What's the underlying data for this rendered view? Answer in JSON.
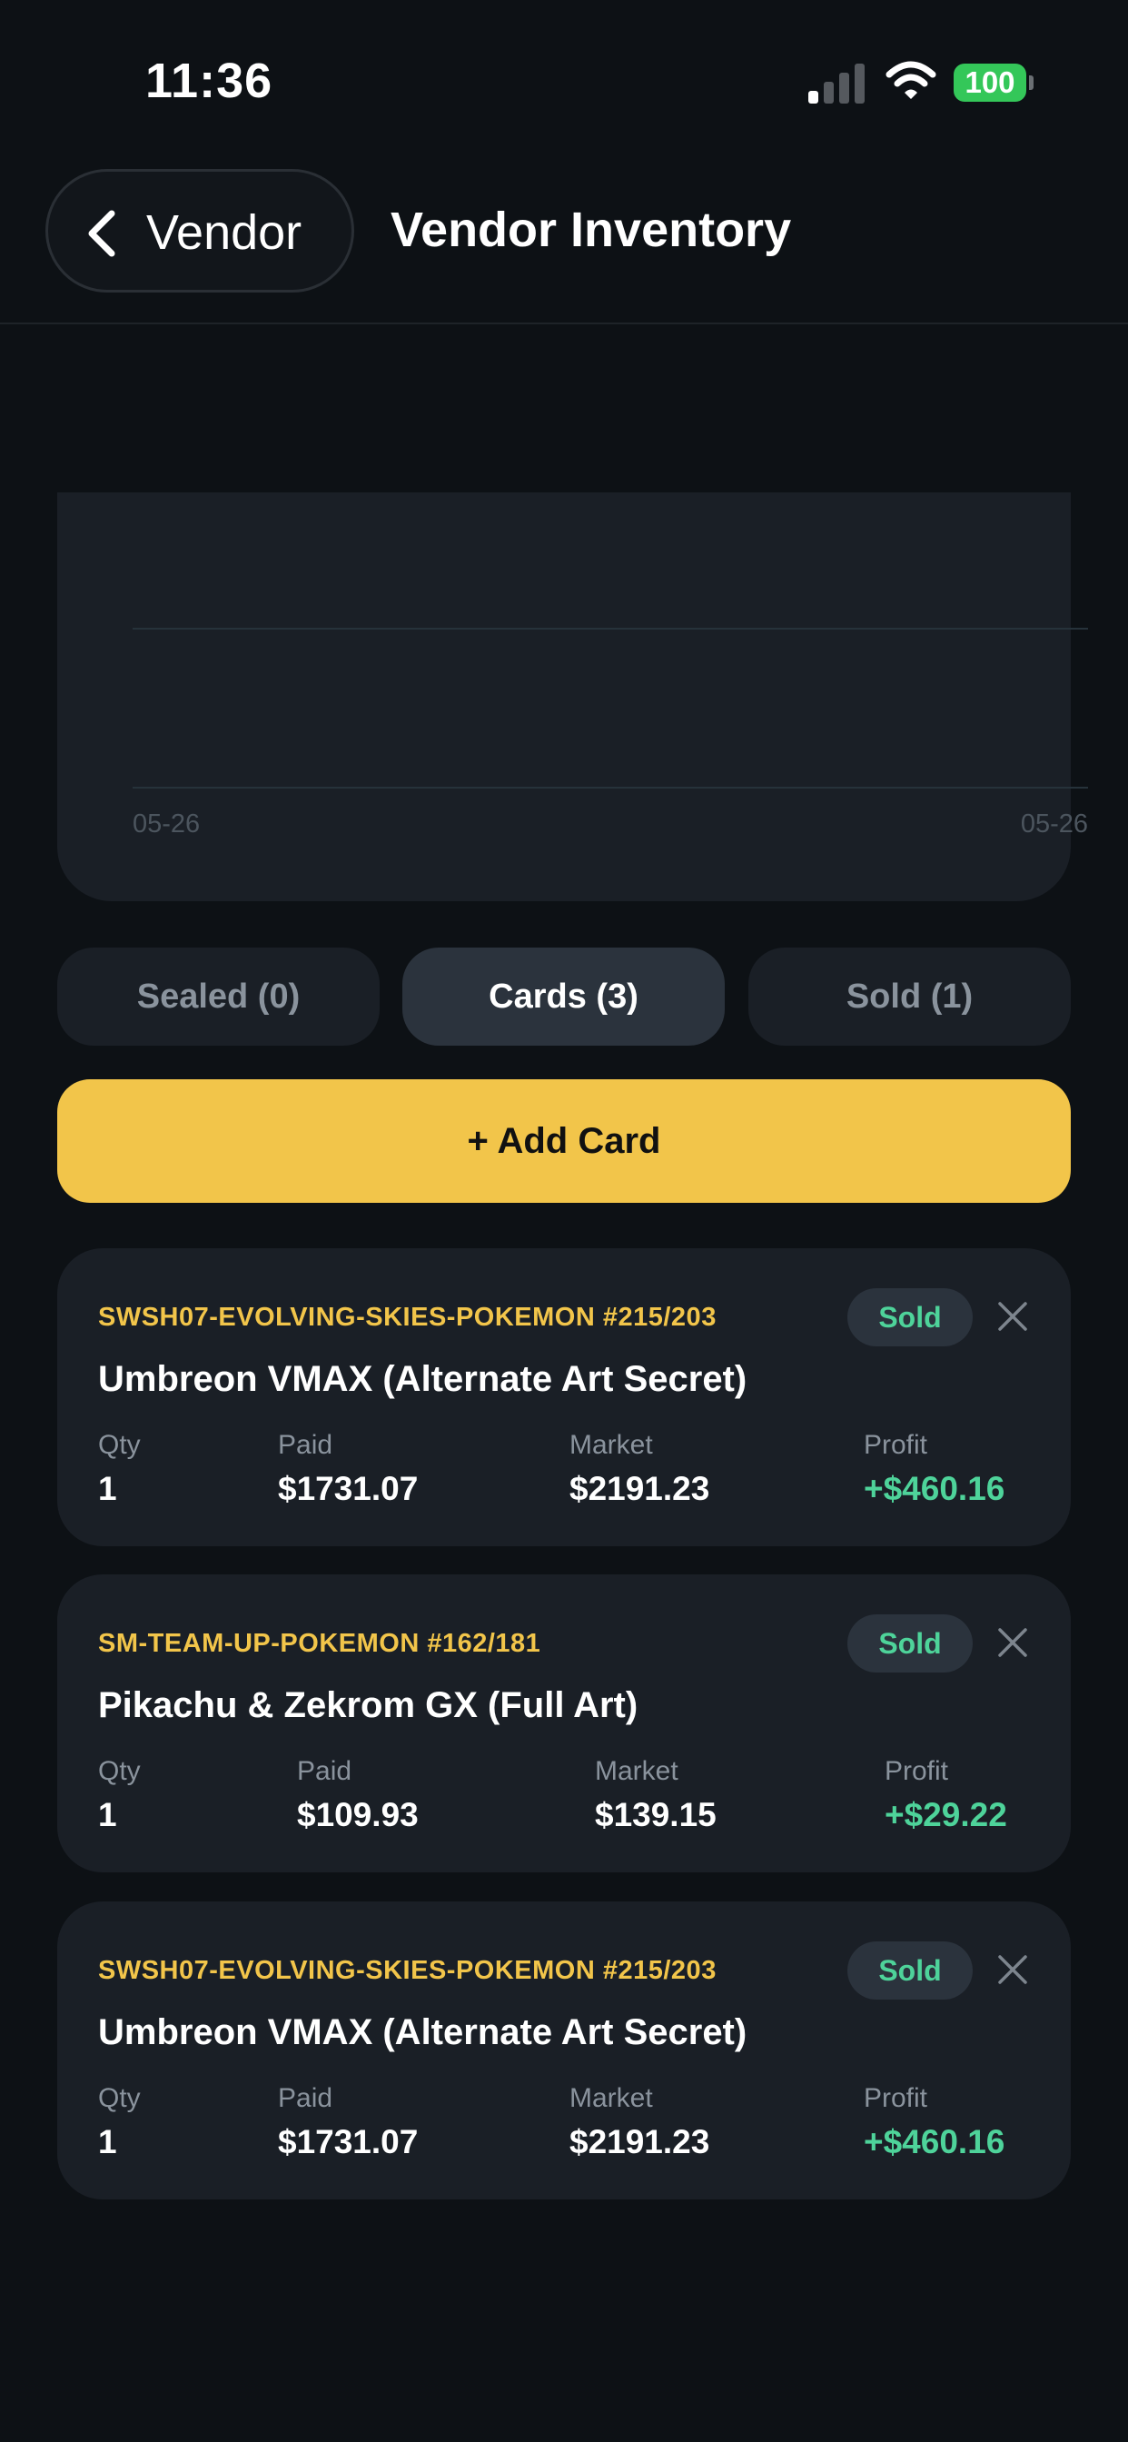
{
  "status_bar": {
    "time": "11:36",
    "battery": "100"
  },
  "header": {
    "back_label": "Vendor",
    "title": "Vendor Inventory"
  },
  "chart_data": {
    "type": "line",
    "x_tick_labels": [
      "05-26",
      "05-26"
    ],
    "series": [],
    "grid": true
  },
  "tabs": [
    {
      "label": "Sealed (0)",
      "active": false
    },
    {
      "label": "Cards (3)",
      "active": true
    },
    {
      "label": "Sold (1)",
      "active": false
    }
  ],
  "add_button_label": "+ Add Card",
  "stat_labels": {
    "qty": "Qty",
    "paid": "Paid",
    "market": "Market",
    "profit": "Profit"
  },
  "items": [
    {
      "set": "SWSH07-EVOLVING-SKIES-POKEMON #215/203",
      "name": "Umbreon VMAX (Alternate Art Secret)",
      "badge": "Sold",
      "qty": "1",
      "paid": "$1731.07",
      "market": "$2191.23",
      "profit": "+$460.16"
    },
    {
      "set": "SM-TEAM-UP-POKEMON #162/181",
      "name": "Pikachu & Zekrom GX (Full Art)",
      "badge": "Sold",
      "qty": "1",
      "paid": "$109.93",
      "market": "$139.15",
      "profit": "+$29.22"
    },
    {
      "set": "SWSH07-EVOLVING-SKIES-POKEMON #215/203",
      "name": "Umbreon VMAX (Alternate Art Secret)",
      "badge": "Sold",
      "qty": "1",
      "paid": "$1731.07",
      "market": "$2191.23",
      "profit": "+$460.16"
    }
  ],
  "colors": {
    "background": "#0d1115",
    "card": "#1a1f26",
    "accent": "#f2c54a",
    "profit": "#4ed39a",
    "muted": "#8a939d"
  }
}
